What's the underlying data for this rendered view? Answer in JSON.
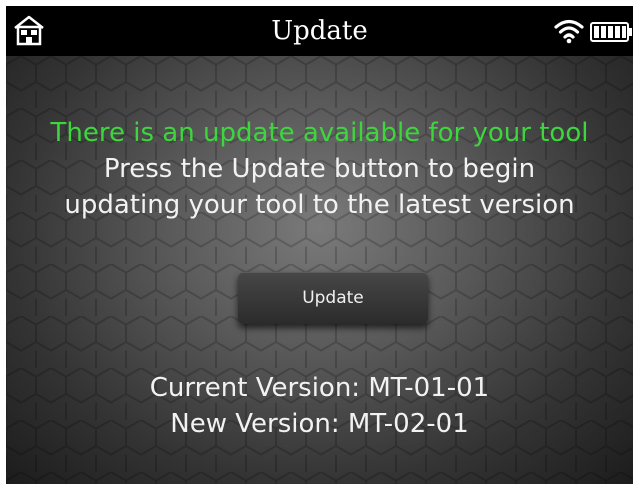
{
  "statusbar": {
    "title": "Update",
    "home_icon": "home-icon",
    "wifi_icon": "wifi-icon",
    "battery_icon": "battery-icon"
  },
  "main": {
    "alert": "There is an update available for your tool",
    "instruction_line1": "Press the Update button to begin",
    "instruction_line2": "updating your tool to the latest version",
    "update_button_label": "Update",
    "current_version": "Current Version: MT-01-01",
    "new_version": "New Version: MT-02-01"
  },
  "colors": {
    "alert_text": "#3dd63d",
    "text": "#f2f2f2",
    "statusbar_bg": "#000000"
  }
}
